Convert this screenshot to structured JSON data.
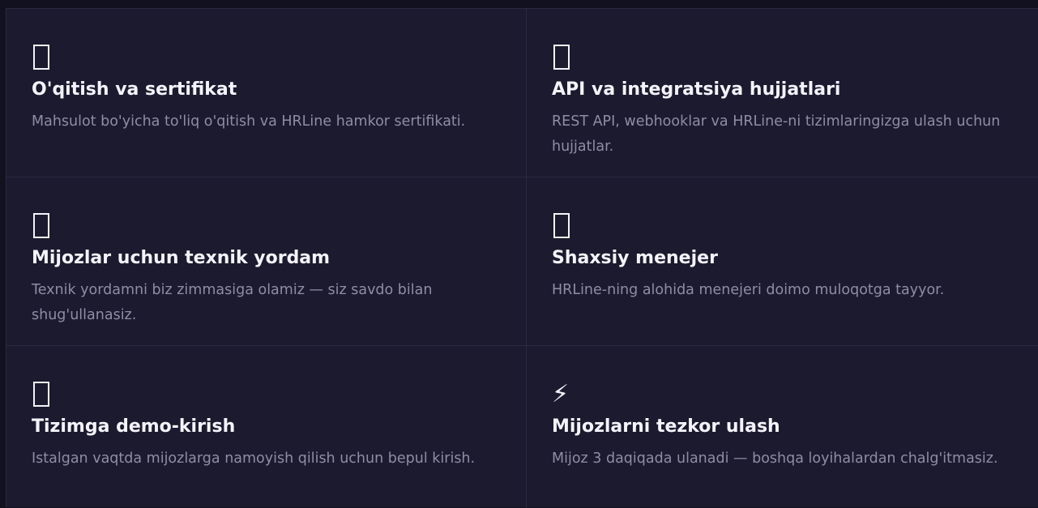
{
  "features": [
    {
      "icon": "certificate-icon",
      "title": "O'qitish va sertifikat",
      "description": "Mahsulot bo'yicha to'liq o'qitish va HRLine hamkor sertifikati."
    },
    {
      "icon": "api-docs-icon",
      "title": "API va integratsiya hujjatlari",
      "description": "REST API, webhooklar va HRLine-ni tizimlaringizga ulash uchun hujjatlar."
    },
    {
      "icon": "support-icon",
      "title": "Mijozlar uchun texnik yordam",
      "description": "Texnik yordamni biz zimmasiga olamiz — siz savdo bilan shug'ullanasiz."
    },
    {
      "icon": "manager-icon",
      "title": "Shaxsiy menejer",
      "description": "HRLine-ning alohida menejeri doimo muloqotga tayyor."
    },
    {
      "icon": "demo-access-icon",
      "title": "Tizimga demo-kirish",
      "description": "Istalgan vaqtda mijozlarga namoyish qilish uchun bepul kirish."
    },
    {
      "icon": "lightning-icon",
      "icon_glyph": "⚡",
      "title": "Mijozlarni tezkor ulash",
      "description": "Mijoz 3 daqiqada ulanadi — boshqa loyihalardan chalg'itmasiz."
    }
  ]
}
